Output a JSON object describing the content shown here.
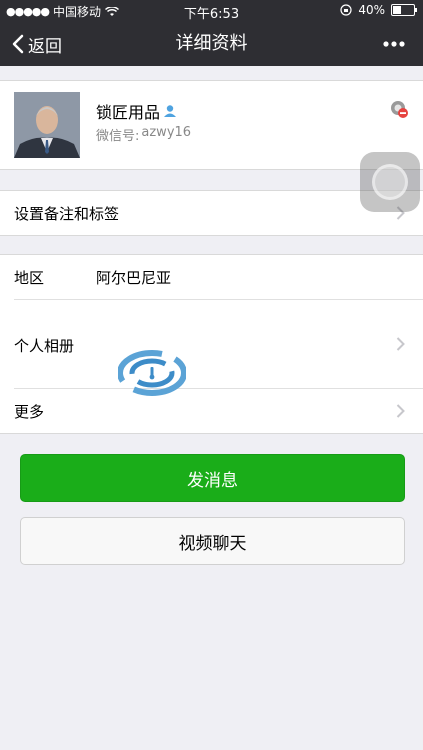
{
  "status_bar": {
    "signal_dots": "●●●●●",
    "carrier": "中国移动",
    "time": "下午6:53",
    "battery_percent": "40%",
    "battery_level": 0.4
  },
  "nav": {
    "back_label": "返回",
    "title": "详细资料",
    "more_icon": "more-dots-icon"
  },
  "profile": {
    "name": "锁匠用品",
    "wechat_id_label": "微信号:",
    "wechat_id": "azwy16"
  },
  "rows": {
    "remark_tags": "设置备注和标签",
    "region_label": "地区",
    "region_value": "阿尔巴尼亚",
    "album": "个人相册",
    "more": "更多"
  },
  "buttons": {
    "send_message": "发消息",
    "video_chat": "视频聊天"
  },
  "colors": {
    "accent_green": "#1aad19",
    "nav_bg": "#2e2e33",
    "page_bg": "#efeff4"
  }
}
